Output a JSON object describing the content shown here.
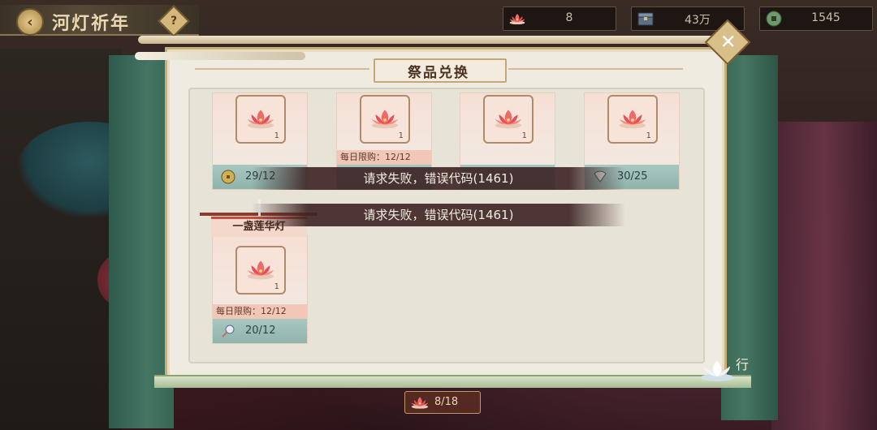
{
  "header": {
    "title": "河灯祈年",
    "help_label": "?"
  },
  "resources": [
    {
      "icon": "lotus-lantern-icon",
      "value": "8"
    },
    {
      "icon": "treasure-chest-icon",
      "value": "43万"
    },
    {
      "icon": "jade-coin-icon",
      "value": "1545"
    }
  ],
  "panel": {
    "title": "祭品兑换",
    "close_label": "✕"
  },
  "items": [
    {
      "qty": "1",
      "limit": "",
      "cost_icon": "gold-coin-icon",
      "cost": "29/12"
    },
    {
      "qty": "1",
      "limit": "每日限购：12/12",
      "cost_icon": "",
      "cost": ""
    },
    {
      "qty": "1",
      "limit": "",
      "cost_icon": "",
      "cost": ""
    },
    {
      "qty": "1",
      "limit": "",
      "cost_icon": "fan-icon",
      "cost": "30/25"
    },
    {
      "qty": "1",
      "name": "一盏莲华灯",
      "limit": "每日限购：12/12",
      "cost_icon": "rattle-icon",
      "cost": "20/12"
    }
  ],
  "toasts": [
    "请求失败，错误代码(1461)",
    "请求失败，错误代码(1461)"
  ],
  "footer": {
    "counter": "8/18",
    "side_label": "行"
  },
  "colors": {
    "panel_bg": "#f0ebe0",
    "frame_green": "#457563",
    "cost_teal": "#9fbfb9",
    "limit_pink": "#f3c7b7",
    "accent_gold": "#c9b07a"
  }
}
